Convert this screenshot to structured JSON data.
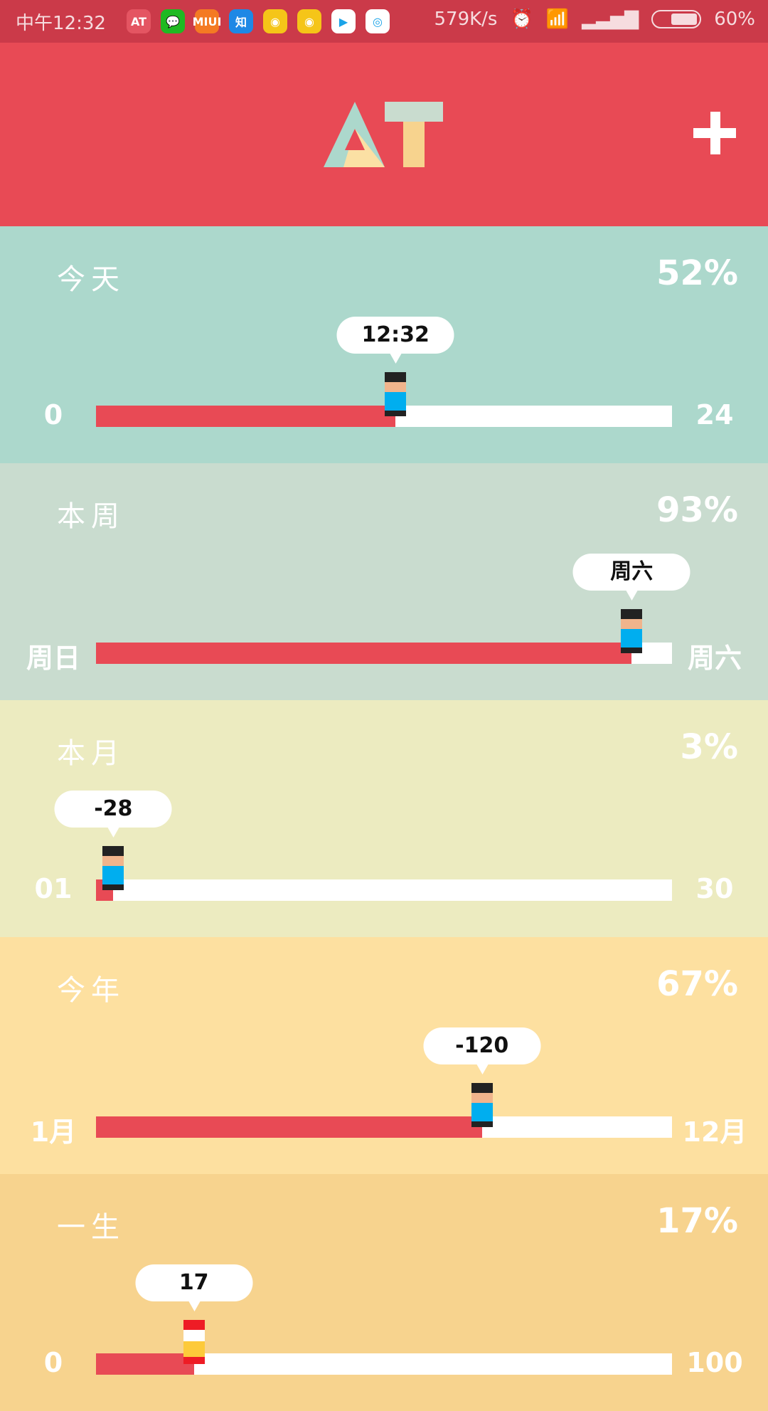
{
  "status_bar": {
    "time": "中午12:32",
    "net_speed": "579K/s",
    "battery": "60%",
    "battery_level": 0.6,
    "apps": [
      {
        "name": "at-app-icon",
        "label": "AT",
        "color": "#e45562"
      },
      {
        "name": "wechat-icon",
        "label": "💬",
        "color": "#1fb922"
      },
      {
        "name": "miui-icon",
        "label": "MIUI",
        "color": "#f47a23"
      },
      {
        "name": "zhihu-icon",
        "label": "知",
        "color": "#1e88e5"
      },
      {
        "name": "weibo-icon",
        "label": "◉",
        "color": "#f5c518"
      },
      {
        "name": "weibo-icon-2",
        "label": "◉",
        "color": "#f5c518"
      },
      {
        "name": "play-store-icon",
        "label": "▶",
        "color": "#ffffff"
      },
      {
        "name": "circle-app-icon",
        "label": "◎",
        "color": "#ffffff"
      }
    ]
  },
  "header": {
    "logo": "AT",
    "add_label": "+"
  },
  "sections": [
    {
      "title": "今天",
      "percent": "52%",
      "value": 52,
      "bubble": "12:32",
      "start": "0",
      "end": "24",
      "bg": "#acd8cc",
      "figure": "person"
    },
    {
      "title": "本周",
      "percent": "93%",
      "value": 93,
      "bubble": "周六",
      "start": "周日",
      "end": "周六",
      "bg": "#c9dccf",
      "figure": "person"
    },
    {
      "title": "本月",
      "percent": "3%",
      "value": 3,
      "bubble": "-28",
      "start": "01",
      "end": "30",
      "bg": "#ecebc0",
      "figure": "person"
    },
    {
      "title": "今年",
      "percent": "67%",
      "value": 67,
      "bubble": "-120",
      "start": "1月",
      "end": "12月",
      "bg": "#fde0a0",
      "figure": "person"
    },
    {
      "title": "一生",
      "percent": "17%",
      "value": 17,
      "bubble": "17",
      "start": "0",
      "end": "100",
      "bg": "#f7d38e",
      "figure": "flag"
    }
  ],
  "colors": {
    "status_bar": "#cb3a49",
    "header": "#e84a55",
    "bar_fill": "#e84a55"
  }
}
